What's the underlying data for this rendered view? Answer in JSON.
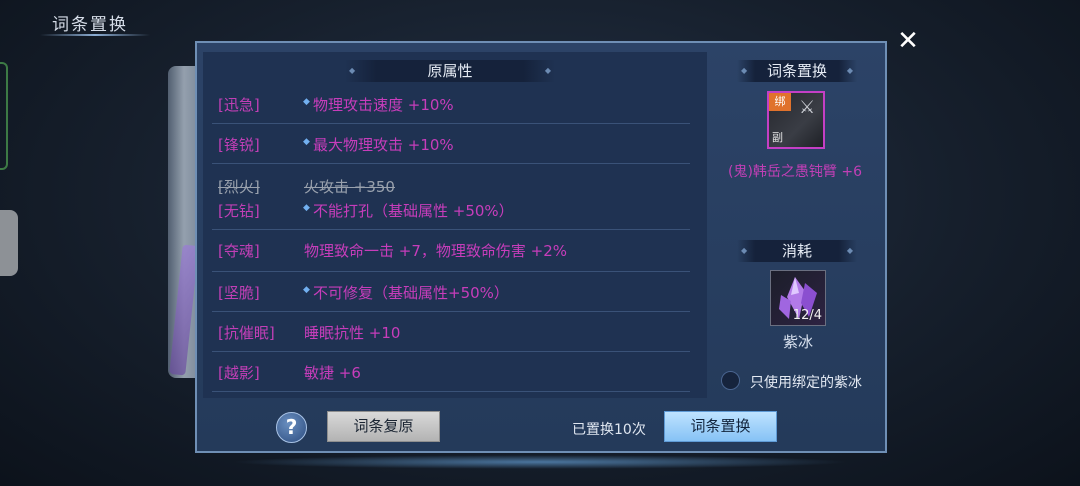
{
  "page_title": "词条置换",
  "left_section": {
    "header": "原属性",
    "rows": [
      {
        "label": "[迅急]",
        "text": "物理攻击速度 +10%",
        "diamond": true,
        "strike": false
      },
      {
        "label": "[锋锐]",
        "text": "最大物理攻击 +10%",
        "diamond": true,
        "strike": false
      },
      {
        "label": "[烈火]",
        "text": "火攻击 +350",
        "diamond": false,
        "strike": true
      },
      {
        "label": "[无钻]",
        "text": "不能打孔（基础属性 +50%）",
        "diamond": true,
        "strike": false
      },
      {
        "label": "[夺魂]",
        "text": "物理致命一击 +7，物理致命伤害 +2%",
        "diamond": false,
        "strike": false
      },
      {
        "label": "[坚脆]",
        "text": "不可修复（基础属性+50%）",
        "diamond": true,
        "strike": false
      },
      {
        "label": "[抗催眠]",
        "text": "睡眠抗性 +10",
        "diamond": false,
        "strike": false
      },
      {
        "label": "[越影]",
        "text": "敏捷 +6",
        "diamond": false,
        "strike": false
      }
    ]
  },
  "right_section": {
    "swap_header": "词条置换",
    "item": {
      "tag": "绑",
      "sub": "副",
      "name": "(鬼)韩岳之愚钝臂 +6"
    },
    "consume_header": "消耗",
    "material": {
      "count": "12/4",
      "name": "紫冰"
    },
    "bound_only_label": "只使用绑定的紫冰"
  },
  "bottom": {
    "help_label": "?",
    "restore_label": "词条复原",
    "swap_count": "已置换10次",
    "swap_label": "词条置换"
  },
  "colors": {
    "attribute_purple": "#c73dbb",
    "panel_blue": "#243a5a",
    "swap_button": "#86c2f5"
  }
}
